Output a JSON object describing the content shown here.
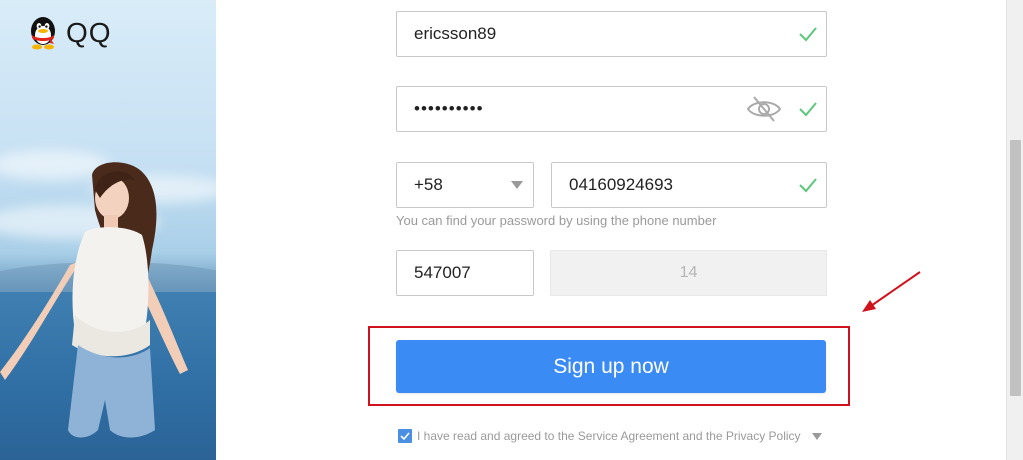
{
  "logo": {
    "text": "QQ"
  },
  "form": {
    "username": {
      "value": "ericsson89"
    },
    "password": {
      "value": "••••••••••"
    },
    "country_code": {
      "value": "+58"
    },
    "phone": {
      "value": "04160924693"
    },
    "phone_hint": "You can find your password by using the phone number",
    "sms_code": {
      "value": "547007"
    },
    "countdown": "14",
    "signup_label": "Sign up now",
    "agreement_text": "I have read and agreed to the Service Agreement and the Privacy Policy",
    "agreement_checked": true
  },
  "colors": {
    "accent": "#3b8bf5",
    "valid_check": "#5cc77b",
    "highlight_border": "#d0121c"
  },
  "icons": [
    "qq-penguin-icon",
    "check-icon",
    "eye-slash-icon",
    "chevron-down-icon",
    "red-arrow-annotation"
  ]
}
